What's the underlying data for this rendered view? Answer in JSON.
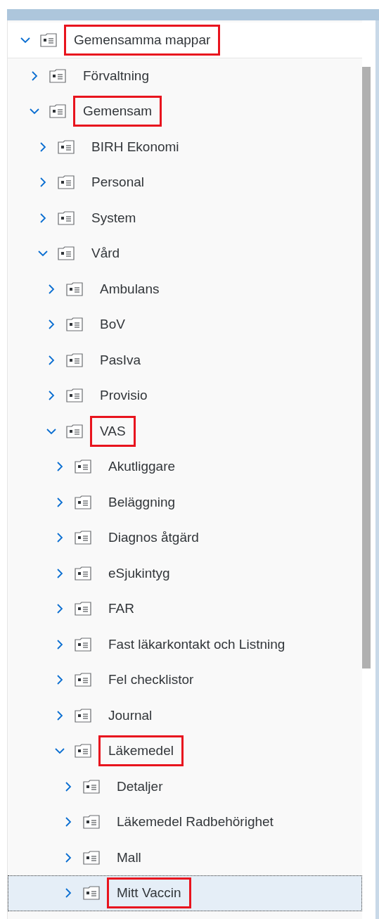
{
  "tree": [
    {
      "label": "Gemensamma mappar",
      "expanded": true,
      "highlighted": true,
      "selected": false,
      "children": [
        {
          "label": "Förvaltning",
          "expanded": false,
          "highlighted": false,
          "selected": false
        },
        {
          "label": "Gemensam",
          "expanded": true,
          "highlighted": true,
          "selected": false,
          "children": [
            {
              "label": "BIRH Ekonomi",
              "expanded": false,
              "highlighted": false,
              "selected": false
            },
            {
              "label": "Personal",
              "expanded": false,
              "highlighted": false,
              "selected": false
            },
            {
              "label": "System",
              "expanded": false,
              "highlighted": false,
              "selected": false
            },
            {
              "label": "Vård",
              "expanded": true,
              "highlighted": false,
              "selected": false,
              "children": [
                {
                  "label": "Ambulans",
                  "expanded": false,
                  "highlighted": false,
                  "selected": false
                },
                {
                  "label": "BoV",
                  "expanded": false,
                  "highlighted": false,
                  "selected": false
                },
                {
                  "label": "PasIva",
                  "expanded": false,
                  "highlighted": false,
                  "selected": false
                },
                {
                  "label": "Provisio",
                  "expanded": false,
                  "highlighted": false,
                  "selected": false
                },
                {
                  "label": "VAS",
                  "expanded": true,
                  "highlighted": true,
                  "selected": false,
                  "children": [
                    {
                      "label": "Akutliggare",
                      "expanded": false,
                      "highlighted": false,
                      "selected": false
                    },
                    {
                      "label": "Beläggning",
                      "expanded": false,
                      "highlighted": false,
                      "selected": false
                    },
                    {
                      "label": "Diagnos åtgärd",
                      "expanded": false,
                      "highlighted": false,
                      "selected": false
                    },
                    {
                      "label": "eSjukintyg",
                      "expanded": false,
                      "highlighted": false,
                      "selected": false
                    },
                    {
                      "label": "FAR",
                      "expanded": false,
                      "highlighted": false,
                      "selected": false
                    },
                    {
                      "label": "Fast läkarkontakt och Listning",
                      "expanded": false,
                      "highlighted": false,
                      "selected": false
                    },
                    {
                      "label": "Fel checklistor",
                      "expanded": false,
                      "highlighted": false,
                      "selected": false
                    },
                    {
                      "label": "Journal",
                      "expanded": false,
                      "highlighted": false,
                      "selected": false
                    },
                    {
                      "label": "Läkemedel",
                      "expanded": true,
                      "highlighted": true,
                      "selected": false,
                      "children": [
                        {
                          "label": "Detaljer",
                          "expanded": false,
                          "highlighted": false,
                          "selected": false
                        },
                        {
                          "label": "Läkemedel Radbehörighet",
                          "expanded": false,
                          "highlighted": false,
                          "selected": false
                        },
                        {
                          "label": "Mall",
                          "expanded": false,
                          "highlighted": false,
                          "selected": false
                        },
                        {
                          "label": "Mitt Vaccin",
                          "expanded": false,
                          "highlighted": true,
                          "selected": true
                        }
                      ]
                    }
                  ]
                }
              ]
            }
          ]
        }
      ]
    }
  ]
}
